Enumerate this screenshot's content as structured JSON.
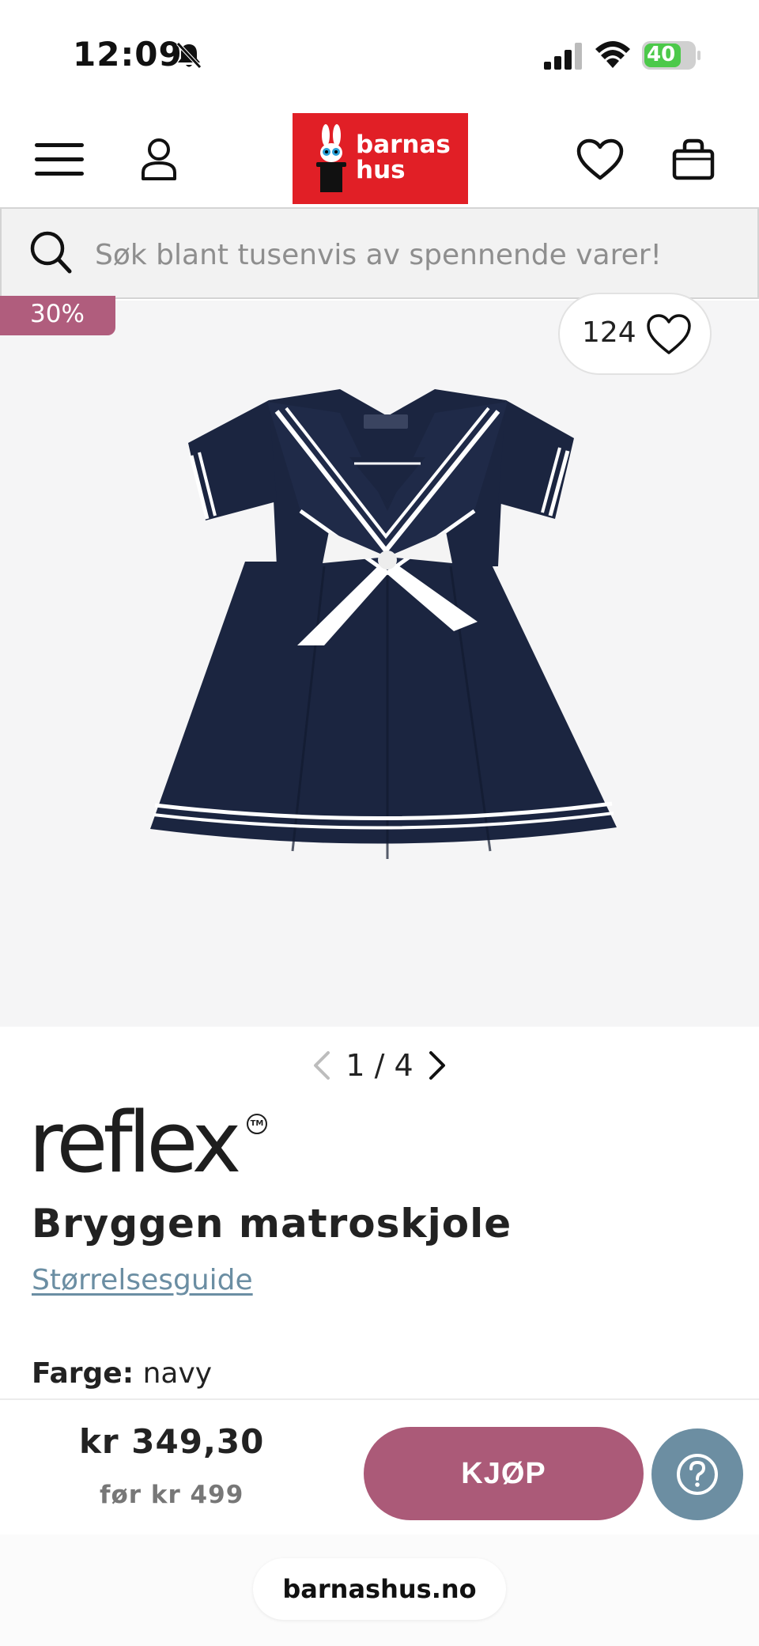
{
  "status_bar": {
    "time": "12:09",
    "battery_level": "40"
  },
  "header": {
    "logo_line1": "barnas",
    "logo_line2": "hus",
    "icons": [
      "menu-icon",
      "user-icon",
      "heart-icon",
      "bag-icon"
    ]
  },
  "search": {
    "placeholder": "Søk blant tusenvis av spennende varer!"
  },
  "product": {
    "discount_badge": "30%",
    "like_count": "124",
    "pager": "1 / 4",
    "brand": "reflex",
    "title": "Bryggen matroskjole",
    "size_guide": "Størrelsesguide",
    "color_label": "Farge:",
    "color_value": "navy"
  },
  "buy_bar": {
    "price": "kr 349,30",
    "before_price": "før kr 499",
    "buy_label": "KJØP"
  },
  "browser": {
    "url": "barnashus.no"
  },
  "colors": {
    "brand_red": "#e11f26",
    "accent_pink": "#ab5a78",
    "help_blue": "#6c8ea2",
    "link_blue": "#6b8ea3",
    "navy": "#1b2540"
  }
}
